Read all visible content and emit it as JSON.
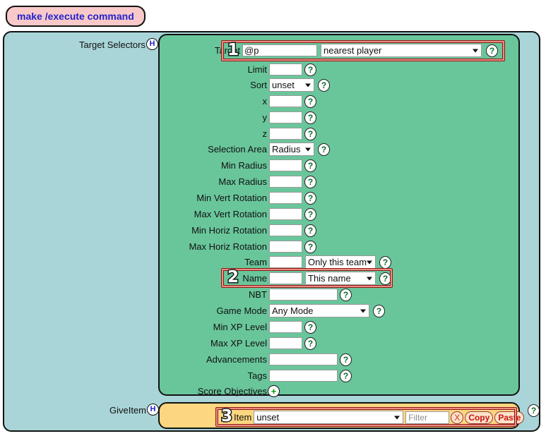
{
  "app": {
    "title": "make /execute command"
  },
  "sections": [
    {
      "label": "Target Selectors",
      "help_letter": "H"
    },
    {
      "label": "GiveItem",
      "help_letter": "H"
    }
  ],
  "badges": {
    "one": "1",
    "two": "2",
    "three": "3"
  },
  "icons": {
    "help": "?",
    "plus": "+",
    "caret": "▼"
  },
  "target_selectors": {
    "fields": [
      {
        "label": "Target",
        "value": "@p",
        "placeholder": "",
        "select": "nearest player"
      },
      {
        "label": "Limit",
        "value": "",
        "placeholder": ""
      },
      {
        "label": "Sort",
        "select": "unset"
      },
      {
        "label": "x",
        "value": "",
        "placeholder": ""
      },
      {
        "label": "y",
        "value": "",
        "placeholder": ""
      },
      {
        "label": "z",
        "value": "",
        "placeholder": ""
      },
      {
        "label": "Selection Area",
        "select": "Radius"
      },
      {
        "label": "Min Radius",
        "value": "",
        "placeholder": ""
      },
      {
        "label": "Max Radius",
        "value": "",
        "placeholder": ""
      },
      {
        "label": "Min Vert Rotation",
        "value": "",
        "placeholder": ""
      },
      {
        "label": "Max Vert Rotation",
        "value": "",
        "placeholder": ""
      },
      {
        "label": "Min Horiz Rotation",
        "value": "",
        "placeholder": ""
      },
      {
        "label": "Max Horiz Rotation",
        "value": "",
        "placeholder": ""
      },
      {
        "label": "Team",
        "value": "",
        "placeholder": "",
        "select": "Only this team"
      },
      {
        "label": "Name",
        "value": "",
        "placeholder": "",
        "select": "This name"
      },
      {
        "label": "NBT",
        "value": "",
        "placeholder": ""
      },
      {
        "label": "Game Mode",
        "select": "Any Mode"
      },
      {
        "label": "Min XP Level",
        "value": "",
        "placeholder": ""
      },
      {
        "label": "Max XP Level",
        "value": "",
        "placeholder": ""
      },
      {
        "label": "Advancements",
        "value": "",
        "placeholder": ""
      },
      {
        "label": "Tags",
        "value": "",
        "placeholder": ""
      },
      {
        "label": "Score Objectives"
      }
    ]
  },
  "give_item": {
    "item_label": "Item",
    "item_select": "unset",
    "filter_placeholder": "Filter",
    "clear_label": "X",
    "copy_label": "Copy",
    "paste_label": "Paste"
  },
  "colors": {
    "outer_panel": "#a9d5d8",
    "green_panel": "#69c69b",
    "orange_panel": "#fdd680",
    "title_pill": "#f9c9c9",
    "title_text": "#2222cc",
    "highlight_border": "#ef8b84",
    "highlight_outline": "#8b1a14",
    "help_text": "#0a6b2a",
    "button_text": "#cc1111"
  }
}
